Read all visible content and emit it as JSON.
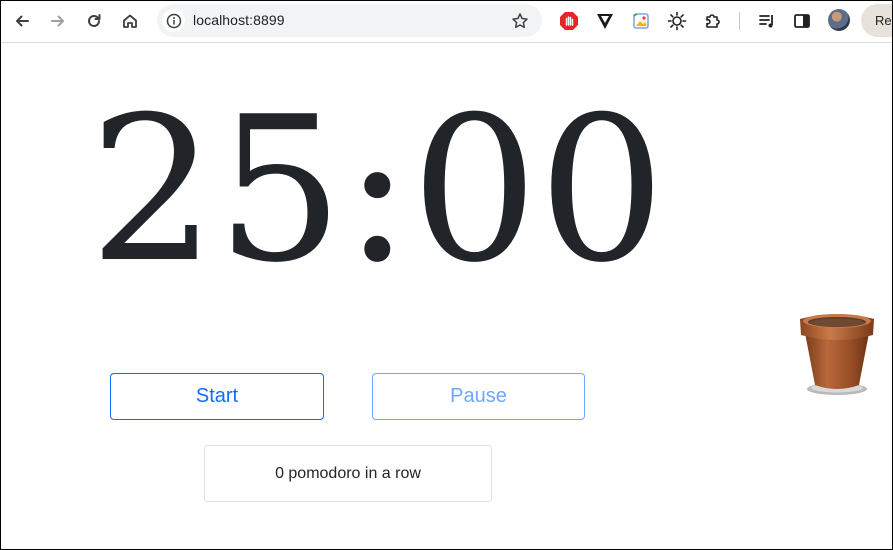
{
  "browser": {
    "url": "localhost:8899",
    "relaunch_label": "Rel",
    "icons": {
      "back": "arrow-left-icon",
      "forward": "arrow-right-icon",
      "reload": "reload-icon",
      "home": "home-icon",
      "site_info": "info-icon",
      "bookmark": "star-icon",
      "extensions": [
        "stop-hand-icon",
        "v-shield-icon",
        "picture-icon",
        "sun-icon",
        "puzzle-icon"
      ],
      "media": "music-list-icon",
      "side_panel": "side-panel-icon"
    }
  },
  "timer": {
    "display": "25:00"
  },
  "controls": {
    "start_label": "Start",
    "pause_label": "Pause"
  },
  "counter": {
    "text": "0 pomodoro in a row"
  },
  "colors": {
    "primary": "#0d6efd",
    "primary_disabled": "#6ea8fe",
    "text": "#212529",
    "pot": "#a0522d"
  }
}
